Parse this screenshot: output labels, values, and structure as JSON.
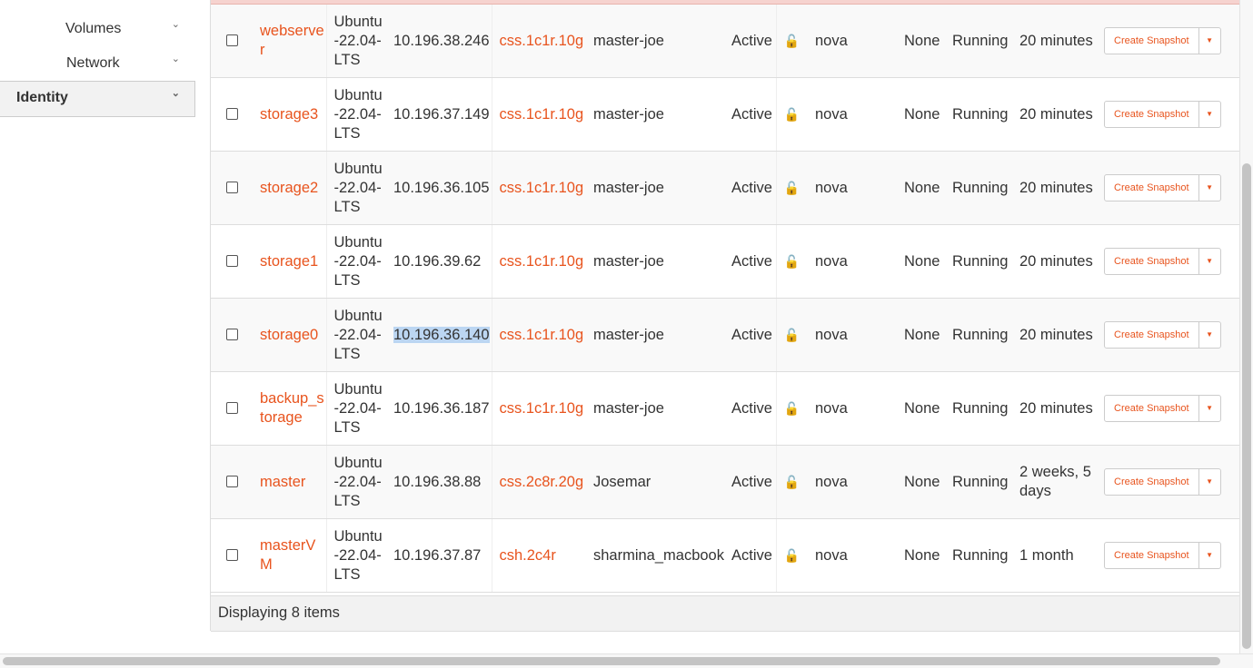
{
  "sidebar": {
    "items": [
      {
        "label": "Volumes",
        "icon": "chevron-down-icon"
      },
      {
        "label": "Network",
        "icon": "chevron-down-icon"
      },
      {
        "label": "Identity",
        "icon": "chevron-down-icon"
      }
    ]
  },
  "table": {
    "action_label": "Create Snapshot",
    "rows": [
      {
        "name": "webserver",
        "image": "Ubuntu-22.04-LTS",
        "ip": "10.196.38.246",
        "flavor": "css.1c1r.10g",
        "keypair": "master-joe",
        "status": "Active",
        "zone": "nova",
        "task": "None",
        "power": "Running",
        "age": "20 minutes"
      },
      {
        "name": "storage3",
        "image": "Ubuntu-22.04-LTS",
        "ip": "10.196.37.149",
        "flavor": "css.1c1r.10g",
        "keypair": "master-joe",
        "status": "Active",
        "zone": "nova",
        "task": "None",
        "power": "Running",
        "age": "20 minutes"
      },
      {
        "name": "storage2",
        "image": "Ubuntu-22.04-LTS",
        "ip": "10.196.36.105",
        "flavor": "css.1c1r.10g",
        "keypair": "master-joe",
        "status": "Active",
        "zone": "nova",
        "task": "None",
        "power": "Running",
        "age": "20 minutes"
      },
      {
        "name": "storage1",
        "image": "Ubuntu-22.04-LTS",
        "ip": "10.196.39.62",
        "flavor": "css.1c1r.10g",
        "keypair": "master-joe",
        "status": "Active",
        "zone": "nova",
        "task": "None",
        "power": "Running",
        "age": "20 minutes"
      },
      {
        "name": "storage0",
        "image": "Ubuntu-22.04-LTS",
        "ip": "10.196.36.140",
        "flavor": "css.1c1r.10g",
        "keypair": "master-joe",
        "status": "Active",
        "zone": "nova",
        "task": "None",
        "power": "Running",
        "age": "20 minutes"
      },
      {
        "name": "backup_storage",
        "image": "Ubuntu-22.04-LTS",
        "ip": "10.196.36.187",
        "flavor": "css.1c1r.10g",
        "keypair": "master-joe",
        "status": "Active",
        "zone": "nova",
        "task": "None",
        "power": "Running",
        "age": "20 minutes"
      },
      {
        "name": "master",
        "image": "Ubuntu-22.04-LTS",
        "ip": "10.196.38.88",
        "flavor": "css.2c8r.20g",
        "keypair": "Josemar",
        "status": "Active",
        "zone": "nova",
        "task": "None",
        "power": "Running",
        "age": "2 weeks, 5 days"
      },
      {
        "name": "masterVM",
        "image": "Ubuntu-22.04-LTS",
        "ip": "10.196.37.87",
        "flavor": "csh.2c4r",
        "keypair": "sharmina_macbook",
        "status": "Active",
        "zone": "nova",
        "task": "None",
        "power": "Running",
        "age": "1 month"
      }
    ],
    "footer": "Displaying 8 items"
  },
  "colors": {
    "link": "#e8541e",
    "highlight": "#bcd6f2"
  }
}
